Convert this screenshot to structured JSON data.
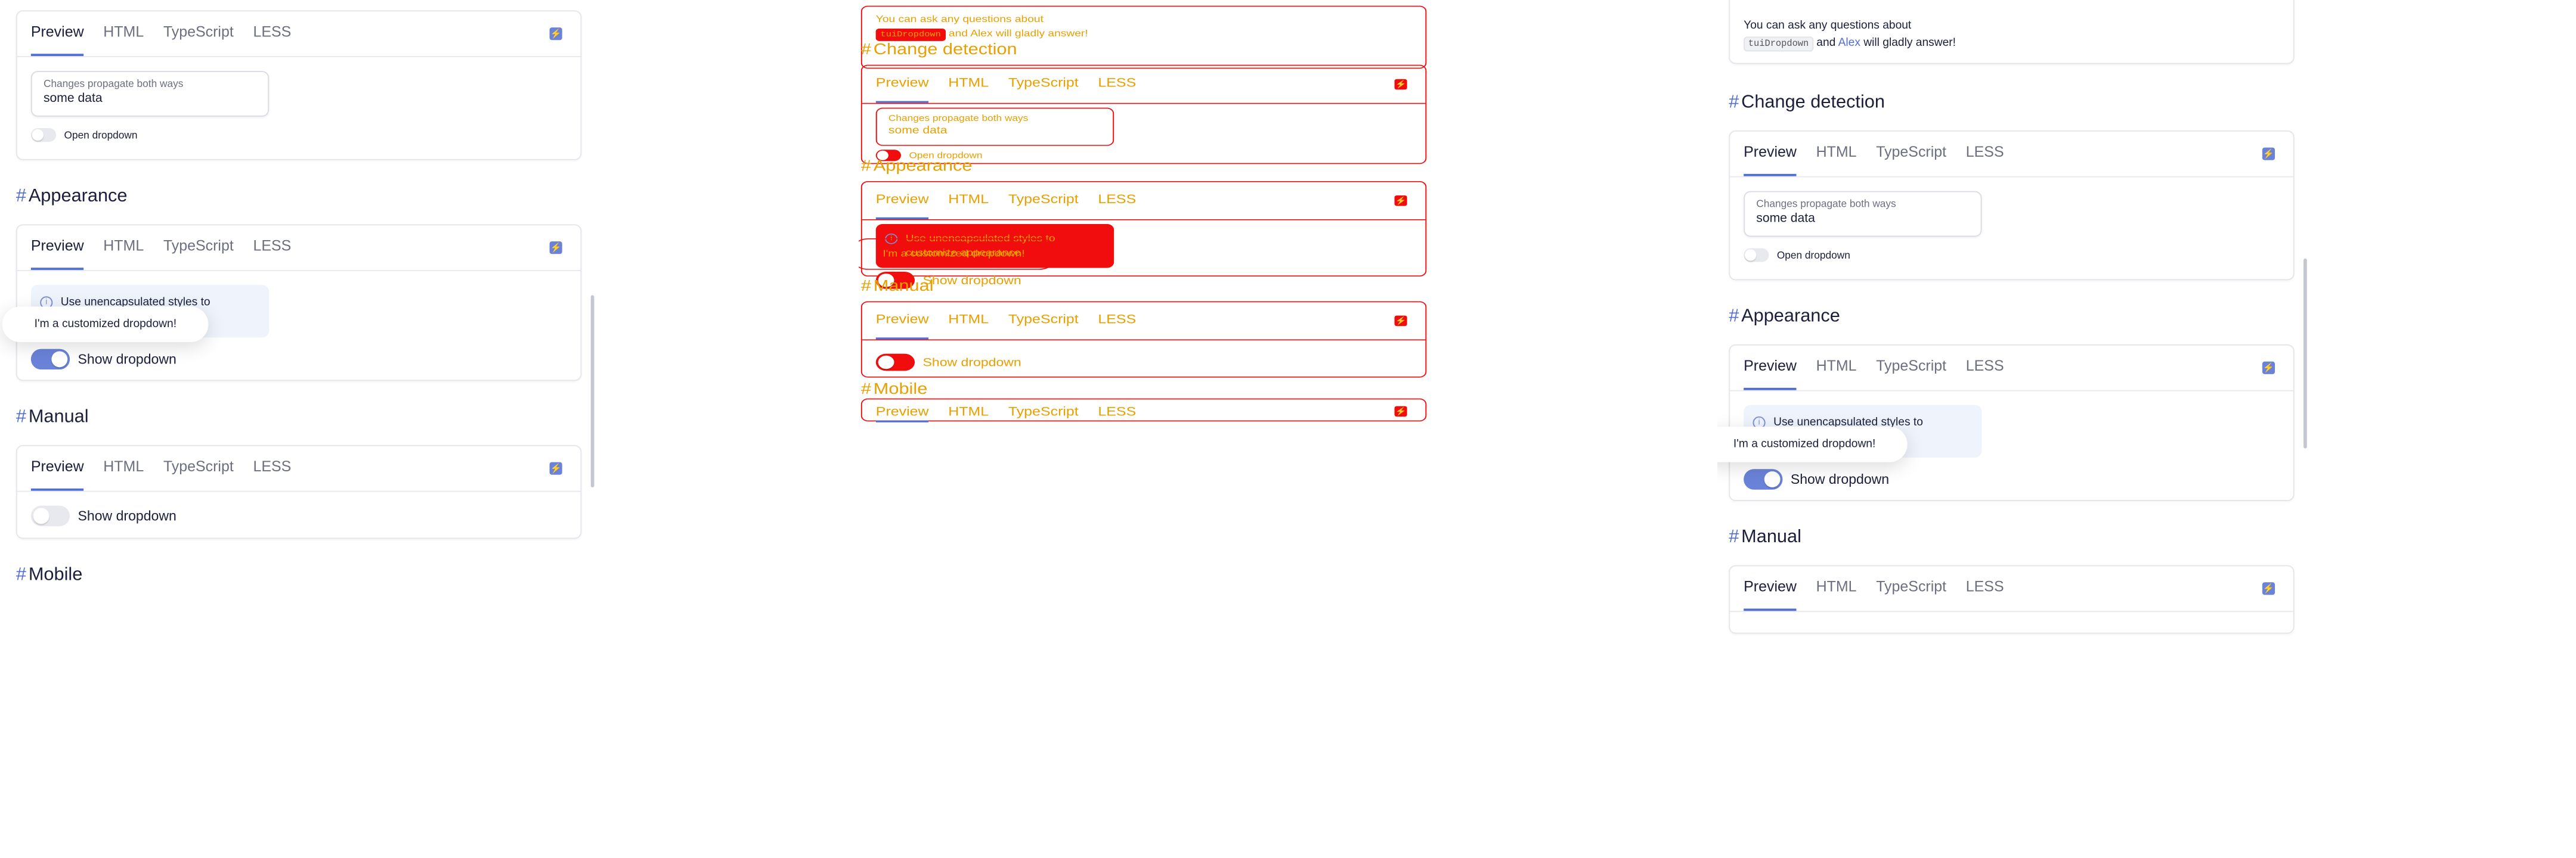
{
  "tabs": [
    "Preview",
    "HTML",
    "TypeScript",
    "LESS"
  ],
  "headings": {
    "appearance": "Appearance",
    "manual": "Manual",
    "mobile": "Mobile",
    "change_detection": "Change detection"
  },
  "hash": "#",
  "stackblitz_icon": "bolt-icon",
  "change_detection_demo": {
    "field_label": "Changes propagate both ways",
    "field_value": "some data",
    "toggle_label": "Open dropdown"
  },
  "appearance_demo": {
    "notice_line1": "Use unencapsulated styles to",
    "notice_line2": "customize appearance",
    "popup_text": "I'm a customized dropdown!",
    "toggle_label": "Show dropdown"
  },
  "manual_demo": {
    "toggle_label": "Show dropdown"
  },
  "ask": {
    "prefix": "You can ask any questions about",
    "code": "tuiDropdown",
    "middle": "and",
    "link": "Alex",
    "suffix": "will gladly answer!"
  },
  "colors": {
    "accent": "#526ed3",
    "toggle_on": "#6a82d8",
    "debug_outline": "#f10d0d",
    "debug_text": "#e8a000"
  }
}
